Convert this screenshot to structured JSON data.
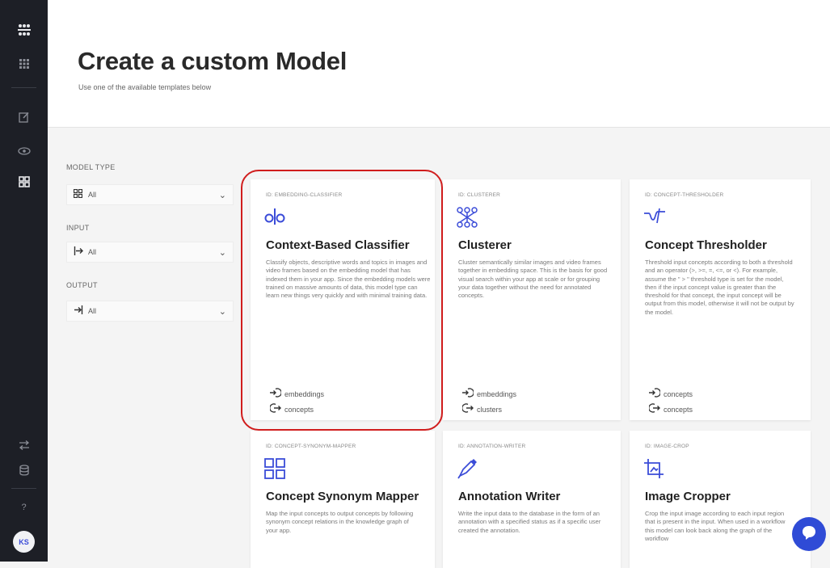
{
  "rail": {
    "items": [
      {
        "icon": "logo-icon"
      },
      {
        "icon": "apps-grid-icon"
      },
      {
        "icon": "edit-icon"
      },
      {
        "icon": "eye-icon"
      },
      {
        "icon": "models-icon"
      },
      {
        "icon": "swap-icon"
      },
      {
        "icon": "database-icon"
      },
      {
        "icon": "help-icon",
        "label": "?"
      }
    ],
    "avatar": "KS"
  },
  "header": {
    "title": "Create a custom Model",
    "subtitle": "Use one of the available templates below"
  },
  "filters": {
    "model_type": {
      "label": "MODEL TYPE",
      "value": "All"
    },
    "input": {
      "label": "INPUT",
      "value": "All"
    },
    "output": {
      "label": "OUTPUT",
      "value": "All"
    }
  },
  "cards": [
    {
      "type": "ID: EMBEDDING-CLASSIFIER",
      "title": "Context-Based Classifier",
      "icon": "classifier-icon",
      "description": "Classify objects, descriptive words and topics in images and video frames based on the embedding model that has indexed them in your app. Since the embedding models were trained on massive amounts of data, this model type can learn new things very quickly and with minimal training data.",
      "inputs": [
        {
          "icon": "input-icon",
          "label": "embeddings"
        }
      ],
      "outputs": [
        {
          "icon": "output-icon",
          "label": "concepts"
        }
      ]
    },
    {
      "type": "ID: CLUSTERER",
      "title": "Clusterer",
      "icon": "cluster-icon",
      "description": "Cluster semantically similar images and video frames together in embedding space. This is the basis for good visual search within your app at scale or for grouping your data together without the need for annotated concepts.",
      "inputs": [
        {
          "icon": "input-icon",
          "label": "embeddings"
        }
      ],
      "outputs": [
        {
          "icon": "output-icon",
          "label": "clusters"
        }
      ]
    },
    {
      "type": "ID: CONCEPT-THRESHOLDER",
      "title": "Concept Thresholder",
      "icon": "threshold-icon",
      "description": "Threshold input concepts according to both a threshold and an operator (>, >=, =, <=, or <). For example, assume the \" > \" threshold type is set for the model, then if the input concept value is greater than the threshold for that concept, the input concept will be output from this model, otherwise it will not be output by the model.",
      "inputs": [
        {
          "icon": "input-icon",
          "label": "concepts"
        }
      ],
      "outputs": [
        {
          "icon": "output-icon",
          "label": "concepts"
        }
      ]
    },
    {
      "type": "ID: CONCEPT-SYNONYM-MAPPER",
      "title": "Concept Synonym Mapper",
      "icon": "synonym-grid-icon",
      "description": "Map the input concepts to output concepts by following synonym concept relations in the knowledge graph of your app."
    },
    {
      "type": "ID: ANNOTATION-WRITER",
      "title": "Annotation Writer",
      "icon": "pen-icon",
      "description": "Write the input data to the database in the form of an annotation with a specified status as if a specific user created the annotation."
    },
    {
      "type": "ID: IMAGE-CROP",
      "title": "Image Cropper",
      "icon": "crop-icon",
      "description": "Crop the input image according to each input region that is present in the input. When used in a workflow this model can look back along the graph of the workflow"
    }
  ],
  "colors": {
    "accent": "#3b4cd8",
    "highlight": "#d01d1d",
    "rail": "#1d1f26"
  }
}
